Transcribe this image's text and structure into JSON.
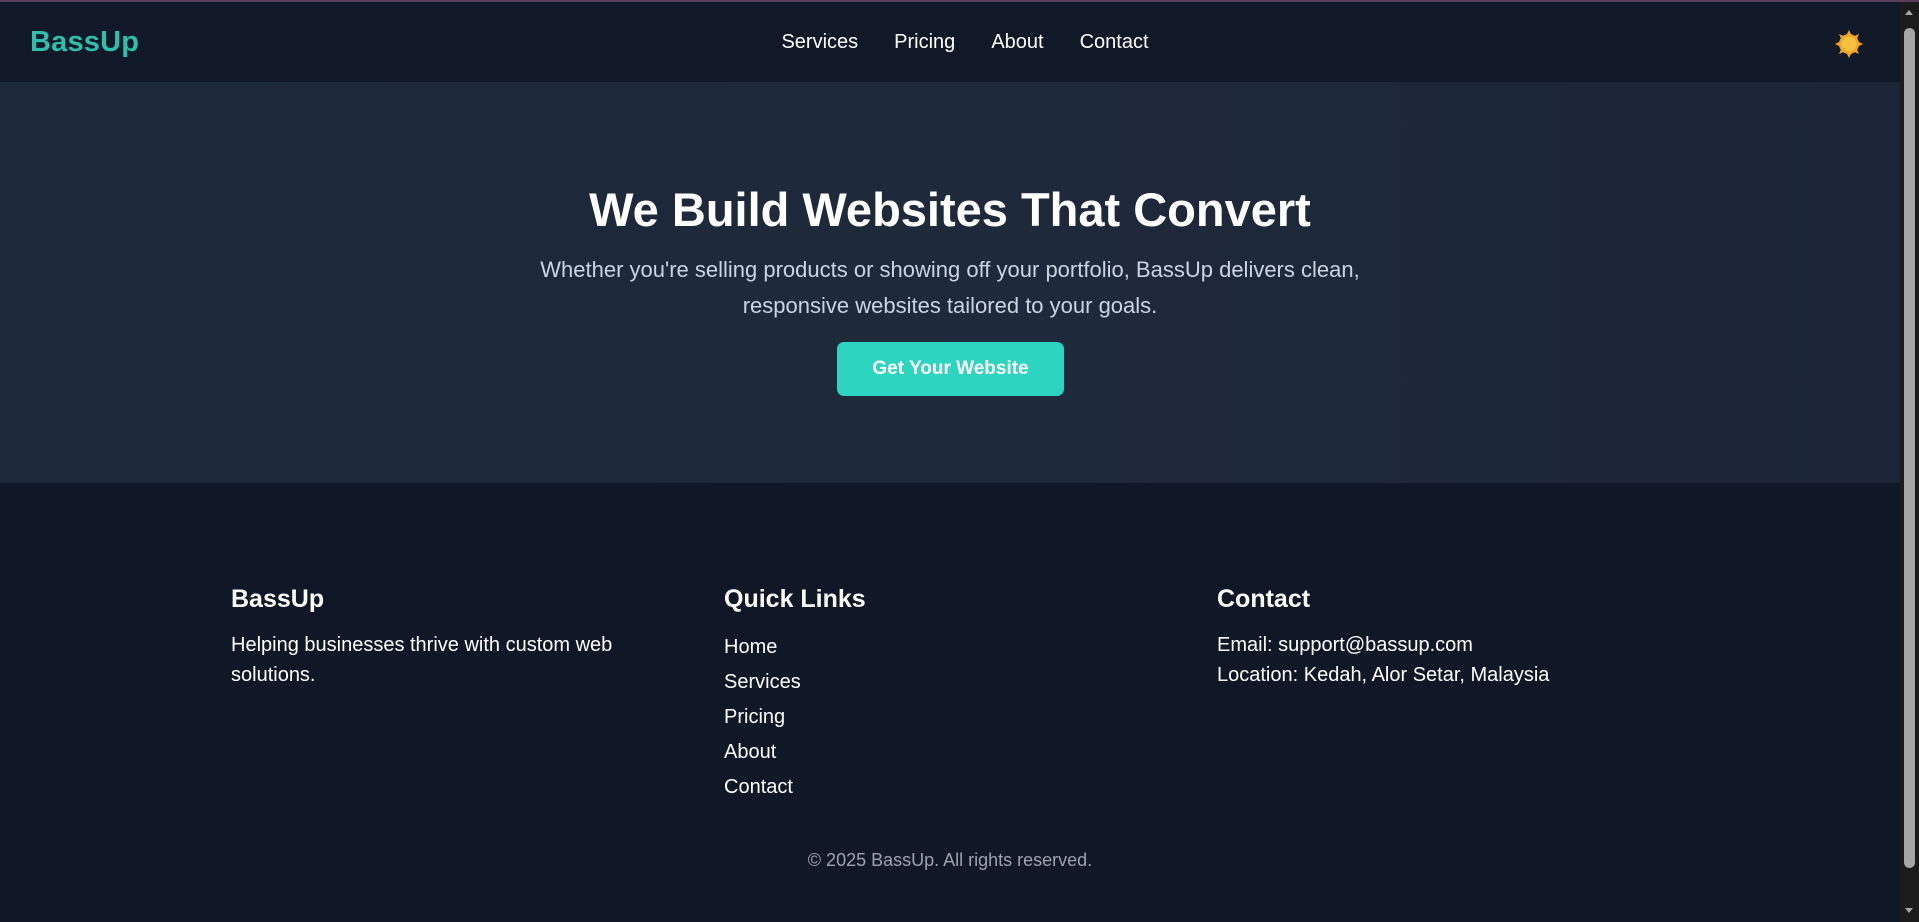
{
  "header": {
    "logo": "BassUp",
    "nav": [
      "Services",
      "Pricing",
      "About",
      "Contact"
    ],
    "theme_icon": "sun-icon"
  },
  "hero": {
    "title": "We Build Websites That Convert",
    "subtitle": "Whether you're selling products or showing off your portfolio, BassUp delivers clean, responsive websites tailored to your goals.",
    "cta_label": "Get Your Website"
  },
  "footer": {
    "about": {
      "heading": "BassUp",
      "text": "Helping businesses thrive with custom web solutions."
    },
    "quick_links": {
      "heading": "Quick Links",
      "links": [
        "Home",
        "Services",
        "Pricing",
        "About",
        "Contact"
      ]
    },
    "contact": {
      "heading": "Contact",
      "email": "Email: support@bassup.com",
      "location": "Location: Kedah, Alor Setar, Malaysia"
    },
    "copyright": "© 2025 BassUp. All rights reserved."
  },
  "colors": {
    "accent": "#2dd4bf",
    "logo": "#2bbfac",
    "background": "#101727",
    "hero_background": "#1e293b",
    "muted_text": "#9ca3af"
  }
}
